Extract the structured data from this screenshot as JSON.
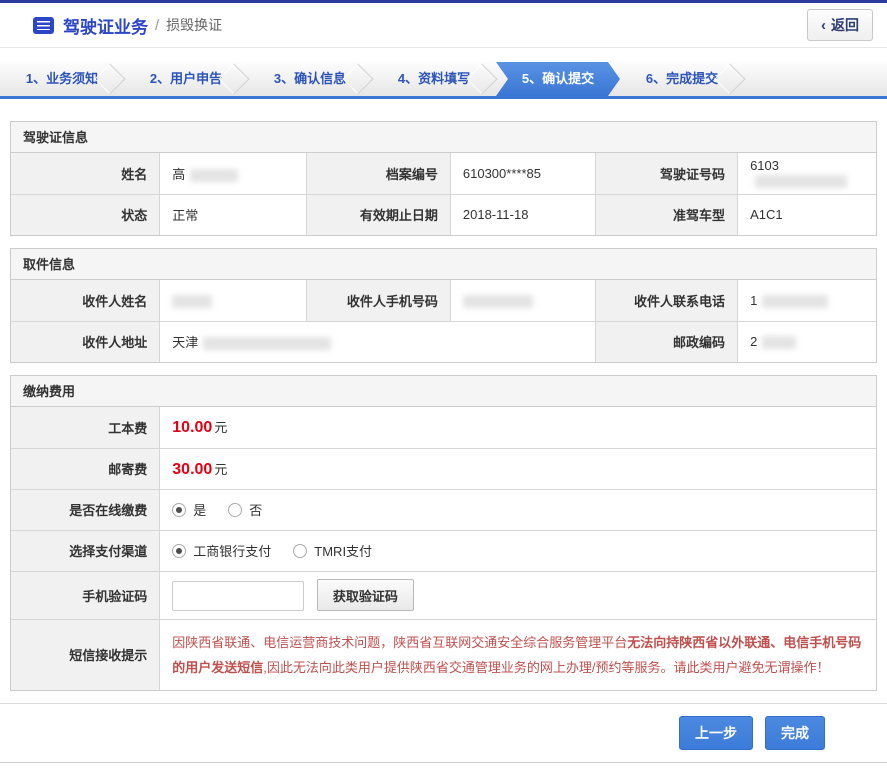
{
  "colors": {
    "brand_blue": "#2c46c8",
    "accent_blue": "#3b76d4",
    "price_red": "#e60012",
    "notice_red": "#c0504d",
    "topbar_navy": "#2c3a9c"
  },
  "header": {
    "title": "驾驶证业务",
    "separator": "/",
    "subtitle": "损毁换证",
    "back": {
      "chevron": "‹",
      "label": "返回"
    }
  },
  "steps": {
    "items": [
      {
        "label": "1、业务须知",
        "active": false
      },
      {
        "label": "2、用户申告",
        "active": false
      },
      {
        "label": "3、确认信息",
        "active": false
      },
      {
        "label": "4、资料填写",
        "active": false
      },
      {
        "label": "5、确认提交",
        "active": true
      },
      {
        "label": "6、完成提交",
        "active": false
      }
    ]
  },
  "license": {
    "title": "驾驶证信息",
    "name": {
      "label": "姓名",
      "value": "高"
    },
    "file_number": {
      "label": "档案编号",
      "value": "610300****85"
    },
    "license_number": {
      "label": "驾驶证号码",
      "value": "6103"
    },
    "status": {
      "label": "状态",
      "value": "正常"
    },
    "valid_until": {
      "label": "有效期止日期",
      "value": "2018-11-18"
    },
    "vehicle_class": {
      "label": "准驾车型",
      "value": "A1C1"
    }
  },
  "pickup": {
    "title": "取件信息",
    "recipient_name": {
      "label": "收件人姓名",
      "value": ""
    },
    "recipient_mobile": {
      "label": "收件人手机号码",
      "value": ""
    },
    "recipient_phone": {
      "label": "收件人联系电话",
      "value": "1"
    },
    "recipient_address": {
      "label": "收件人地址",
      "value": "天津"
    },
    "postal_code": {
      "label": "邮政编码",
      "value": "2"
    }
  },
  "payment": {
    "title": "缴纳费用",
    "production_fee": {
      "label": "工本费",
      "amount": "10.00",
      "unit": "元"
    },
    "postage_fee": {
      "label": "邮寄费",
      "amount": "30.00",
      "unit": "元"
    },
    "online_pay": {
      "label": "是否在线缴费",
      "options": [
        {
          "label": "是",
          "selected": true
        },
        {
          "label": "否",
          "selected": false
        }
      ]
    },
    "pay_channel": {
      "label": "选择支付渠道",
      "options": [
        {
          "label": "工商银行支付",
          "selected": true
        },
        {
          "label": "TMRI支付",
          "selected": false
        }
      ]
    },
    "sms_code": {
      "label": "手机验证码",
      "value": "",
      "button_label": "获取验证码"
    },
    "sms_notice": {
      "label": "短信接收提示",
      "text_pre": "因陕西省联通、电信运营商技术问题，陕西省互联网交通安全综合服务管理平台",
      "text_bold": "无法向持陕西省以外联通、电信手机号码的用户发送短信",
      "text_post": ",因此无法向此类用户提供陕西省交通管理业务的网上办理/预约等服务。请此类用户避免无谓操作！"
    }
  },
  "footer": {
    "prev_label": "上一步",
    "finish_label": "完成"
  }
}
